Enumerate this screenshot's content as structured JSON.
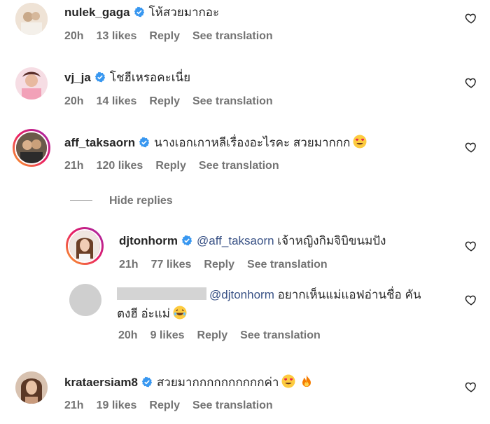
{
  "comments": [
    {
      "username": "nulek_gaga",
      "text": "โห้สวยมากอะ",
      "time": "20h",
      "likes": "13 likes",
      "reply": "Reply",
      "translate": "See translation"
    },
    {
      "username": "vj_ja",
      "text": "โชฮีเหรอคะเนี่ย",
      "time": "20h",
      "likes": "14 likes",
      "reply": "Reply",
      "translate": "See translation"
    },
    {
      "username": "aff_taksaorn",
      "text": "นางเอกเกาหลีเรื่องอะไรคะ สวยมากกก",
      "time": "21h",
      "likes": "120 likes",
      "reply": "Reply",
      "translate": "See translation"
    },
    {
      "username": "djtonhorm",
      "mention": "@aff_taksaorn",
      "text": "เจ้าหญิงกิมจิบิขนมปัง",
      "time": "21h",
      "likes": "77 likes",
      "reply": "Reply",
      "translate": "See translation"
    },
    {
      "mention": "@djtonhorm",
      "text_line1": "อยากเห็นแม่แอฟอ่านชื่อ คัน",
      "text_line2": "ตงฮี อ่ะแม่",
      "time": "20h",
      "likes": "9 likes",
      "reply": "Reply",
      "translate": "See translation"
    },
    {
      "username": "krataersiam8",
      "text": "สวยมากกกกกกกกกกค่า",
      "time": "21h",
      "likes": "19 likes",
      "reply": "Reply",
      "translate": "See translation"
    }
  ],
  "hide_replies": "Hide replies",
  "colors": {
    "verified": "#3897f0",
    "meta": "#737373",
    "mention": "#385185"
  }
}
